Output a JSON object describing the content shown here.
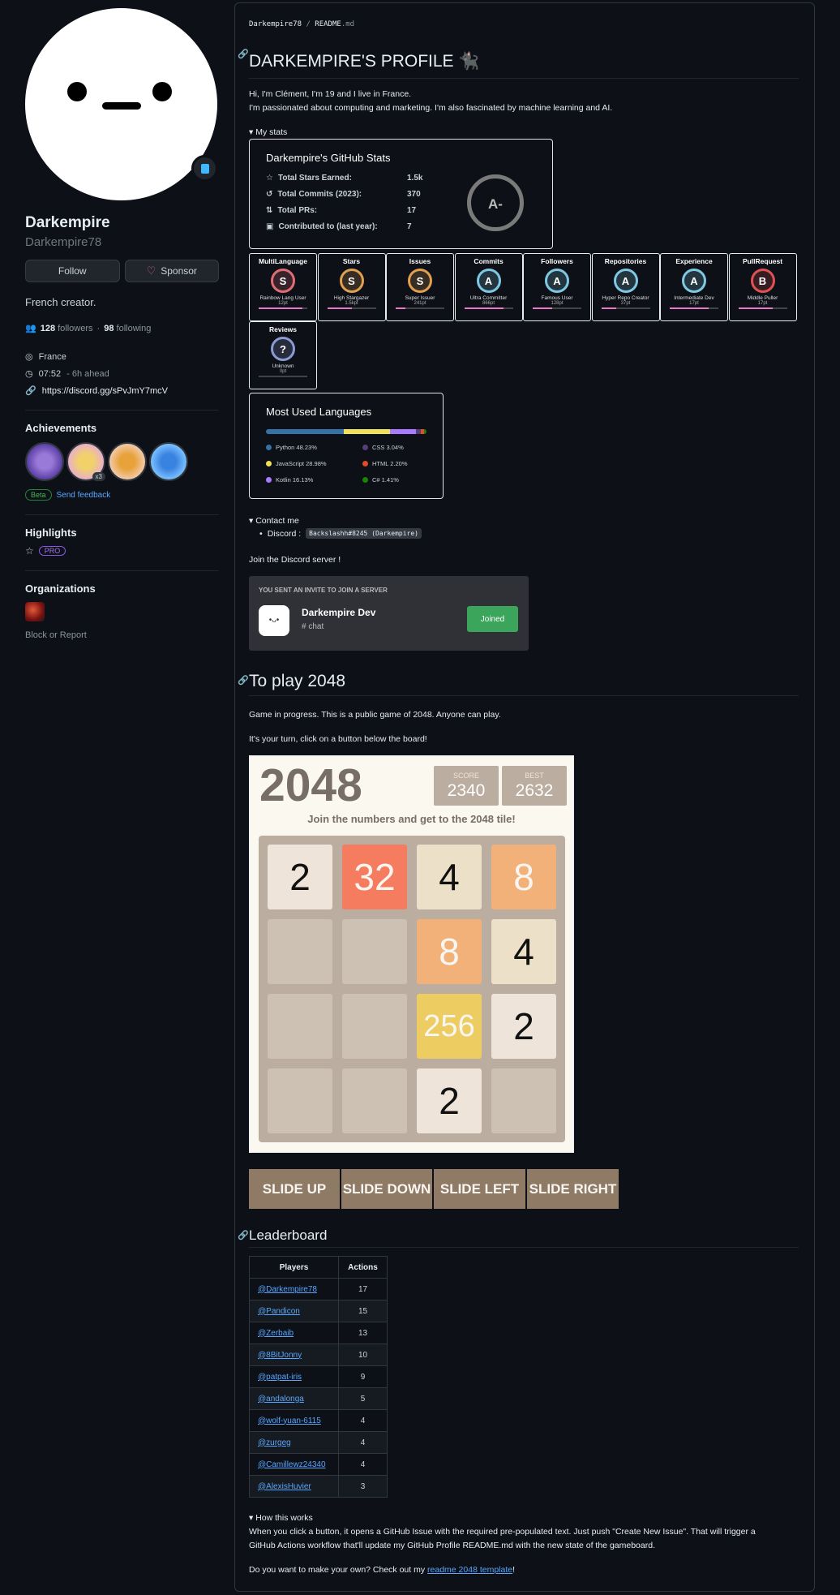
{
  "profile": {
    "name": "Darkempire",
    "login": "Darkempire78",
    "follow_label": "Follow",
    "sponsor_label": "Sponsor",
    "bio": "French creator.",
    "followers": "128",
    "followers_label": "followers",
    "following": "98",
    "following_label": "following",
    "location": "France",
    "time": "07:52",
    "time_note": "- 6h ahead",
    "link": "https://discord.gg/sPvJmY7mcV",
    "achievements_title": "Achievements",
    "achievement_count": "x3",
    "beta_label": "Beta",
    "feedback_label": "Send feedback",
    "highlights_title": "Highlights",
    "pro_label": "PRO",
    "organizations_title": "Organizations",
    "block_label": "Block or Report"
  },
  "readme": {
    "breadcrumb_user": "Darkempire78",
    "breadcrumb_sep": "/",
    "breadcrumb_file": "README",
    "breadcrumb_ext": ".md",
    "title": "DARKEMPIRE'S PROFILE",
    "intro1": "Hi, I'm Clément, I'm 19 and I live in France.",
    "intro2": "I'm passionated about computing and marketing. I'm also fascinated by machine learning and AI.",
    "stats_summary": "My stats",
    "contact_summary": "Contact me",
    "discord_label": "Discord :",
    "discord_tag": "Backslashh#8245 (Darkempire)",
    "join_text": "Join the Discord server !",
    "play_title": "To play 2048",
    "game_text1": "Game in progress. This is a public game of 2048. Anyone can play.",
    "game_text2": "It's your turn, click on a button below the board!",
    "leaderboard_title": "Leaderboard",
    "how_summary": "How this works",
    "how_text1": "When you click a button, it opens a GitHub Issue with the required pre-populated text. Just push \"Create New Issue\". That will trigger a",
    "how_text2": "GitHub Actions workflow that'll update my GitHub Profile README.md with the new state of the gameboard.",
    "own_text": "Do you want to make your own? Check out my",
    "own_link": "readme 2048 template",
    "own_end": "!"
  },
  "stats": {
    "title": "Darkempire's GitHub Stats",
    "rows": [
      {
        "label": "Total Stars Earned:",
        "value": "1.5k"
      },
      {
        "label": "Total Commits (2023):",
        "value": "370"
      },
      {
        "label": "Total PRs:",
        "value": "17"
      },
      {
        "label": "Contributed to (last year):",
        "value": "7"
      }
    ],
    "grade": "A-"
  },
  "trophies": [
    {
      "title": "MultiLanguage",
      "rank": "S",
      "name": "Rainbow Lang User",
      "pt": "12pt",
      "color": "#e06c75",
      "progress": 0.9
    },
    {
      "title": "Stars",
      "rank": "S",
      "name": "High Stargazer",
      "pt": "1.5kpt",
      "color": "#e0a050",
      "progress": 0.5
    },
    {
      "title": "Issues",
      "rank": "S",
      "name": "Super Issuer",
      "pt": "241pt",
      "color": "#e0a050",
      "progress": 0.2
    },
    {
      "title": "Commits",
      "rank": "A",
      "name": "Ultra Committer",
      "pt": "866pt",
      "color": "#7ec8e3",
      "progress": 0.8
    },
    {
      "title": "Followers",
      "rank": "A",
      "name": "Famous User",
      "pt": "128pt",
      "color": "#7ec8e3",
      "progress": 0.4
    },
    {
      "title": "Repositories",
      "rank": "A",
      "name": "Hyper Repo Creator",
      "pt": "37pt",
      "color": "#7ec8e3",
      "progress": 0.3
    },
    {
      "title": "Experience",
      "rank": "A",
      "name": "Intermediate Dev",
      "pt": "17pt",
      "color": "#7ec8e3",
      "progress": 0.8
    },
    {
      "title": "PullRequest",
      "rank": "B",
      "name": "Middle Puller",
      "pt": "17pt",
      "color": "#e05252",
      "progress": 0.7
    },
    {
      "title": "Reviews",
      "rank": "?",
      "name": "Unknown",
      "pt": "0pt",
      "color": "#8a9bd4",
      "progress": 0
    }
  ],
  "languages": {
    "title": "Most Used Languages",
    "items": [
      {
        "name": "Python 48.23%",
        "color": "#3572A5",
        "pct": 48.23
      },
      {
        "name": "JavaScript 28.98%",
        "color": "#f1e05a",
        "pct": 28.98
      },
      {
        "name": "Kotlin 16.13%",
        "color": "#A97BFF",
        "pct": 16.13
      },
      {
        "name": "CSS 3.04%",
        "color": "#563d7c",
        "pct": 3.04
      },
      {
        "name": "HTML 2.20%",
        "color": "#e34c26",
        "pct": 2.2
      },
      {
        "name": "C# 1.41%",
        "color": "#178600",
        "pct": 1.41
      }
    ]
  },
  "discord": {
    "header": "YOU SENT AN INVITE TO JOIN A SERVER",
    "server": "Darkempire Dev",
    "channel": "chat",
    "joined": "Joined"
  },
  "game": {
    "title": "2048",
    "score_label": "SCORE",
    "score": "2340",
    "best_label": "BEST",
    "best": "2632",
    "subtitle": "Join the numbers and get to the 2048 tile!",
    "board": [
      [
        "2",
        "32",
        "4",
        "8"
      ],
      [
        "",
        "",
        "8",
        "4"
      ],
      [
        "",
        "",
        "256",
        "2"
      ],
      [
        "",
        "",
        "2",
        ""
      ]
    ],
    "buttons": [
      "SLIDE UP",
      "SLIDE DOWN",
      "SLIDE LEFT",
      "SLIDE RIGHT"
    ]
  },
  "leaderboard": {
    "headers": [
      "Players",
      "Actions"
    ],
    "rows": [
      {
        "player": "@Darkempire78",
        "actions": "17"
      },
      {
        "player": "@Pandicon",
        "actions": "15"
      },
      {
        "player": "@Zerbaib",
        "actions": "13"
      },
      {
        "player": "@8BitJonny",
        "actions": "10"
      },
      {
        "player": "@patpat-iris",
        "actions": "9"
      },
      {
        "player": "@andalonga",
        "actions": "5"
      },
      {
        "player": "@wolf-yuan-6115",
        "actions": "4"
      },
      {
        "player": "@zurgeg",
        "actions": "4"
      },
      {
        "player": "@Camillewz24340",
        "actions": "4"
      },
      {
        "player": "@AlexisHuvier",
        "actions": "3"
      }
    ]
  }
}
